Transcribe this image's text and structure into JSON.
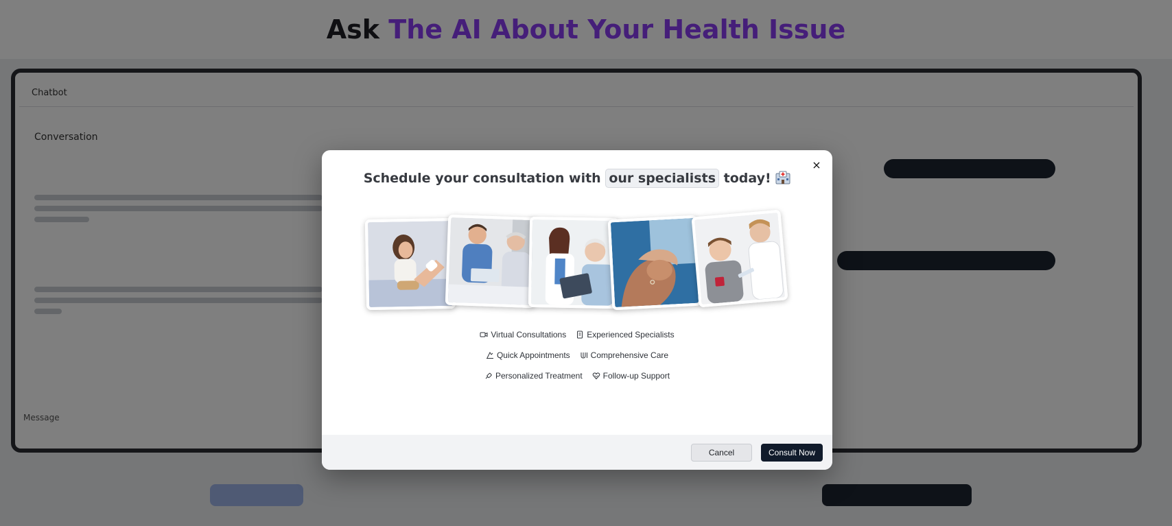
{
  "background": {
    "title_prefix": "Ask",
    "title_accent": "The AI About Your Health Issue",
    "panel_bar_label": "Chatbot",
    "panel_subtitle": "Conversation",
    "panel_footer_label": "Message"
  },
  "modal": {
    "title_before": "Schedule your consultation with",
    "title_highlight": "our specialists",
    "title_after": "today!",
    "title_emoji": "hospital-icon",
    "close_label": "×",
    "features": [
      [
        {
          "icon": "video-camera-icon",
          "label": "Virtual Consultations"
        },
        {
          "icon": "id-badge-icon",
          "label": "Experienced Specialists"
        }
      ],
      [
        {
          "icon": "calendar-icon",
          "label": "Quick Appointments"
        },
        {
          "icon": "stethoscope-icon",
          "label": "Comprehensive Care"
        }
      ],
      [
        {
          "icon": "syringe-icon",
          "label": "Personalized Treatment"
        },
        {
          "icon": "heart-handshake-icon",
          "label": "Follow-up Support"
        }
      ]
    ],
    "photos": [
      "girl-with-knee-bandage-photo",
      "nurse-with-elderly-patient-photo",
      "doctor-with-tablet-photo",
      "holding-hands-photo",
      "boy-getting-vaccine-photo"
    ],
    "cancel_label": "Cancel",
    "consult_label": "Consult Now"
  },
  "colors": {
    "accent": "#8a3df2",
    "primary_button": "#111b2b",
    "footer_bg": "#f2f3f5"
  }
}
